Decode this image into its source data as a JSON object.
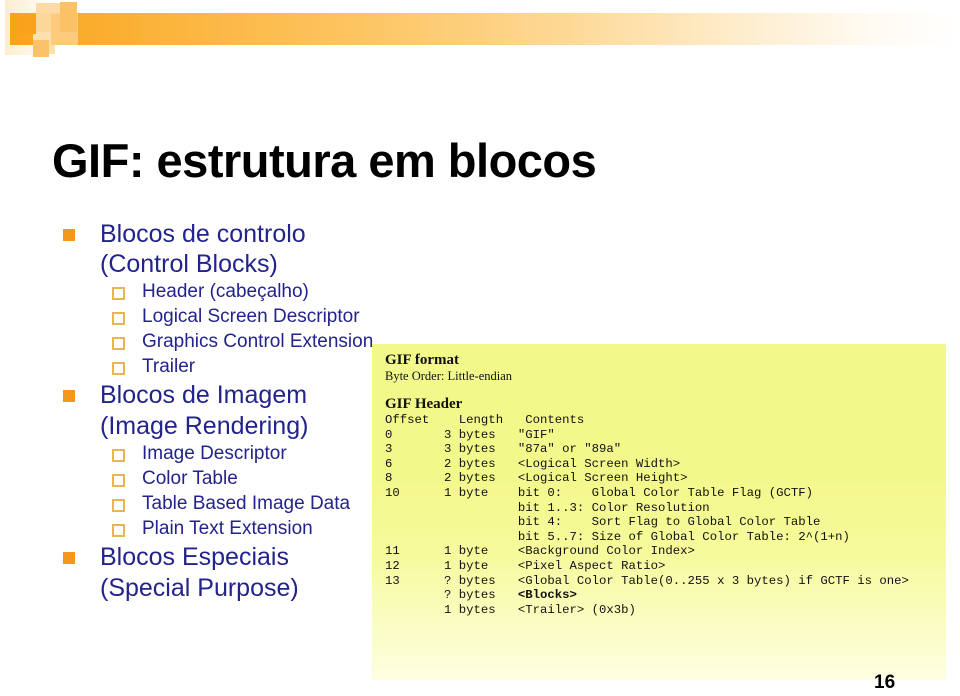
{
  "slide": {
    "title": "GIF: estrutura em blocos",
    "page_number": "16",
    "accent_orange": "#f3981c",
    "text_blue": "#23238c",
    "panel_yellow": "#f3f88a"
  },
  "bullets": [
    {
      "level": 1,
      "label": "Blocos de controlo (Control Blocks)"
    },
    {
      "level": 2,
      "label": "Header (cabeçalho)"
    },
    {
      "level": 2,
      "label": "Logical Screen Descriptor"
    },
    {
      "level": 2,
      "label": "Graphics Control Extension"
    },
    {
      "level": 2,
      "label": "Trailer"
    },
    {
      "level": 1,
      "label": "Blocos de Imagem"
    },
    {
      "level": 1,
      "continuation": true,
      "label": "(Image Rendering)"
    },
    {
      "level": 2,
      "label": "Image Descriptor"
    },
    {
      "level": 2,
      "label": "Color Table"
    },
    {
      "level": 2,
      "label": "Table Based Image Data"
    },
    {
      "level": 2,
      "label": "Plain Text Extension"
    },
    {
      "level": 1,
      "label": "Blocos Especiais"
    },
    {
      "level": 1,
      "continuation": true,
      "label": "(Special Purpose)"
    }
  ],
  "code_panel": {
    "heading_1": "GIF format",
    "subheading_1": "Byte Order: Little-endian",
    "heading_2": "GIF Header",
    "lines": [
      "Offset    Length   Contents",
      "0       3 bytes   \"GIF\"",
      "3       3 bytes   \"87a\" or \"89a\"",
      "6       2 bytes   <Logical Screen Width>",
      "8       2 bytes   <Logical Screen Height>",
      "10      1 byte    bit 0:    Global Color Table Flag (GCTF)",
      "                  bit 1..3: Color Resolution",
      "                  bit 4:    Sort Flag to Global Color Table",
      "                  bit 5..7: Size of Global Color Table: 2^(1+n)",
      "11      1 byte    <Background Color Index>",
      "12      1 byte    <Pixel Aspect Ratio>",
      "13      ? bytes   <Global Color Table(0..255 x 3 bytes) if GCTF is one>",
      "        ? bytes   <Blocks>",
      "        1 bytes   <Trailer> (0x3b)"
    ],
    "bold_line_index": 12
  }
}
